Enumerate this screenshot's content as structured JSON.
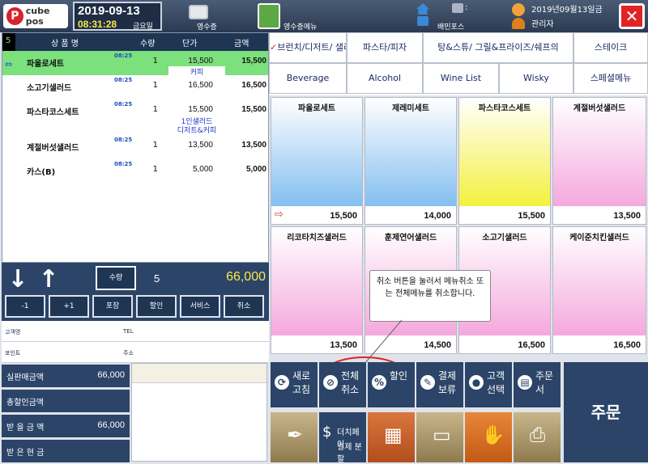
{
  "app": {
    "logo_text": "cube pos",
    "logo_letter": "P"
  },
  "header": {
    "date": "2019-09-13",
    "time": "08:31:28",
    "weekday": "금요일",
    "receipt_label": "영수증",
    "receipt_menu_label": "영수증메뉴",
    "delivery_label": "배민포스",
    "colon": ":",
    "full_date": "2019년09월13일금",
    "user": "관리자"
  },
  "order_table": {
    "count": "5",
    "headers": {
      "name": "상 품 명",
      "qty": "수량",
      "price": "단가",
      "amount": "금액"
    },
    "rows": [
      {
        "time": "08:25",
        "name": "파올로세트",
        "qty": "1",
        "price": "15,500",
        "amount": "15,500",
        "sub": "커피"
      },
      {
        "time": "08:25",
        "name": "소고기샐러드",
        "qty": "1",
        "price": "16,500",
        "amount": "16,500",
        "sub": ""
      },
      {
        "time": "08:25",
        "name": "파스타코스세트",
        "qty": "1",
        "price": "15,500",
        "amount": "15,500",
        "sub": "1인샐러드",
        "sub2": "디저트&커피"
      },
      {
        "time": "08:25",
        "name": "계절버섯샐러드",
        "qty": "1",
        "price": "13,500",
        "amount": "13,500",
        "sub": ""
      },
      {
        "time": "08:25",
        "name": "카스(B)",
        "qty": "1",
        "price": "5,000",
        "amount": "5,000",
        "sub": ""
      }
    ]
  },
  "controls": {
    "qty_label": "수량",
    "qty_value": "5",
    "total": "66,000",
    "buttons": [
      "-1",
      "+1",
      "포장",
      "할인",
      "서비스",
      "취소"
    ]
  },
  "customer": {
    "name_label": "고객명",
    "tel_label": "TEL",
    "point_label": "포인트",
    "address_label": "주소"
  },
  "summary": [
    {
      "label": "실판매금액",
      "value": "66,000"
    },
    {
      "label": "총할인금액",
      "value": ""
    },
    {
      "label": "받 을 금 액",
      "value": "66,000"
    },
    {
      "label": "받 은 현 금",
      "value": ""
    }
  ],
  "categories": {
    "row1": [
      "브런치/디저트/ 샐러드",
      "파스타/피자",
      "탕&스튜/ 그릴&프라이즈/쉐프의",
      "스테이크"
    ],
    "row2": [
      "Beverage",
      "Alcohol",
      "Wine List",
      "Wisky",
      "스페셜메뉴"
    ]
  },
  "menu_items": [
    {
      "name": "파올로세트",
      "price": "15,500",
      "color": "blue"
    },
    {
      "name": "제레미세트",
      "price": "14,000",
      "color": "blue"
    },
    {
      "name": "파스타코스세트",
      "price": "15,500",
      "color": "yellow"
    },
    {
      "name": "계절버섯샐러드",
      "price": "13,500",
      "color": "pink"
    },
    {
      "name": "리코타치즈샐러드",
      "price": "13,500",
      "color": "pink"
    },
    {
      "name": "훈제연어샐러드",
      "price": "14,500",
      "color": "pink"
    },
    {
      "name": "소고기샐러드",
      "price": "16,500",
      "color": "pink"
    },
    {
      "name": "케이준치킨샐러드",
      "price": "16,500",
      "color": "pink"
    }
  ],
  "callout": "취소 버튼을 눌러서 메뉴취소 또는 전체메뉴를 취소합니다.",
  "actions": [
    {
      "label": "새로 고침",
      "icon": "refresh-icon"
    },
    {
      "label": "전체 취소",
      "icon": "cancel-icon"
    },
    {
      "label": "할인",
      "icon": "percent-icon"
    },
    {
      "label": "결제 보류",
      "icon": "pen-icon"
    },
    {
      "label": "고객 선택",
      "icon": "person-icon"
    },
    {
      "label": "주문서",
      "icon": "printer-icon"
    }
  ],
  "bottom_actions": [
    {
      "label": "",
      "icon": "pen-nib-icon"
    },
    {
      "label": "더치페이",
      "sub": "결제 분할",
      "icon": "money-bag-icon"
    },
    {
      "label": "",
      "icon": "calculator-icon"
    },
    {
      "label": "",
      "icon": "card-icon"
    },
    {
      "label": "",
      "icon": "hand-coin-icon"
    },
    {
      "label": "",
      "icon": "receipt-printer-icon"
    }
  ],
  "order_button": "주문",
  "colors": {
    "header": "#2b3a52",
    "selected_row": "#7ce07c",
    "total": "#ffe84a",
    "highlight": "#e02424"
  }
}
